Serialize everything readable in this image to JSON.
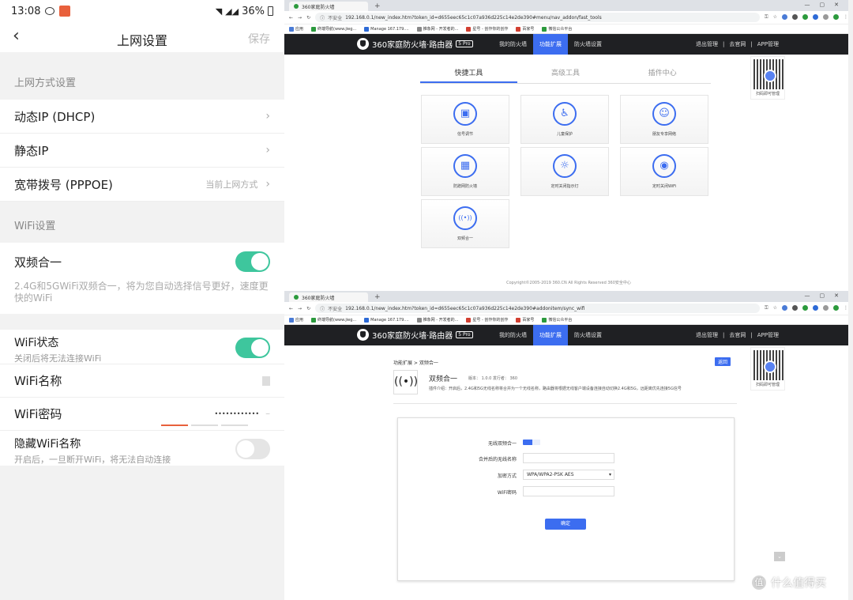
{
  "phone": {
    "status": {
      "time": "13:08",
      "battery": "36%"
    },
    "title": "上网设置",
    "save": "保存",
    "section1": "上网方式设置",
    "dhcp": "动态IP (DHCP)",
    "static_ip": "静态IP",
    "pppoe": "宽带拨号 (PPPOE)",
    "pppoe_hint": "当前上网方式",
    "section2": "WiFi设置",
    "dual_band": "双频合一",
    "dual_band_desc": "2.4G和5GWiFi双频合一，将为您自动选择信号更好，速度更快的WiFi",
    "wifi_status": "WiFi状态",
    "wifi_status_sub": "关闭后将无法连接WiFi",
    "wifi_name": "WiFi名称",
    "wifi_pwd": "WiFi密码",
    "wifi_pwd_value": "••••••••••••",
    "hide_name": "隐藏WiFi名称",
    "hide_name_sub": "开启后，一旦断开WiFi，将无法自动连接",
    "accent": "#3ec69d"
  },
  "browser1": {
    "tab": "360家庭防火墙",
    "url_ins": "不安全",
    "url": "192.168.0.1/new_index.htm?token_id=d655eec65c1c07a936d225c14e2de390#menu/nav_addon/fast_tools",
    "bookmarks": [
      "应用",
      "终端导航(www.jieg...",
      "Manage 167.179....",
      " 推象网 - 开发者的...",
      "星号 - 创作你的创作",
      "百家号",
      "微信公众平台"
    ]
  },
  "browser2": {
    "tab": "360家庭防火墙",
    "url_ins": "不安全",
    "url": "192.168.0.1/new_index.htm?token_id=d655eec65c1c07a936d225c14e2de390#addonitem/sync_wifi"
  },
  "router": {
    "brand": "360家庭防火墙·路由器",
    "model": "5 Pro",
    "nav": [
      "我的防火墙",
      "功能扩展",
      "防火墙设置"
    ],
    "nav_right": [
      "退出管理",
      "去官网",
      "APP管理"
    ],
    "qr_label": "扫码即可管理",
    "tabs": [
      "快捷工具",
      "高级工具",
      "插件中心"
    ],
    "tiles": [
      {
        "label": "信号调节",
        "glyph": "▣"
      },
      {
        "label": "儿童保护",
        "glyph": "♿"
      },
      {
        "label": "朋友专享网络",
        "glyph": "☺"
      },
      {
        "label": "防蹭网防火墙",
        "glyph": "▦"
      },
      {
        "label": "定时关闭指示灯",
        "glyph": "☼"
      },
      {
        "label": "定时关闭WiFi",
        "glyph": "◉"
      },
      {
        "label": "双频合一",
        "glyph": "((•))"
      }
    ],
    "copyright": "Copyright©2005-2019 360.CN All Rights Reserved 360安全中心",
    "breadcrumb": "功能扩展 > 双频合一",
    "back": "返回",
    "plugin_name": "双频合一",
    "plugin_version": "版本： 1.0.0    发行者： 360",
    "plugin_intro": "插件介绍：开启后，2.4G和5G无线名称将合并为一个无线名称，路由器将根据无线客户端设备连接自动切换2.4G和5G，远距离优先连接5G信号",
    "form": {
      "switch_label": "无线双频合一",
      "name_label": "合并后的无线名称",
      "encrypt_label": "加密方式",
      "encrypt_value": "WPA/WPA2-PSK AES",
      "pwd_label": "WiFi密码",
      "ok": "确定"
    },
    "watermark": "什么值得买",
    "accent": "#3c6df0"
  }
}
